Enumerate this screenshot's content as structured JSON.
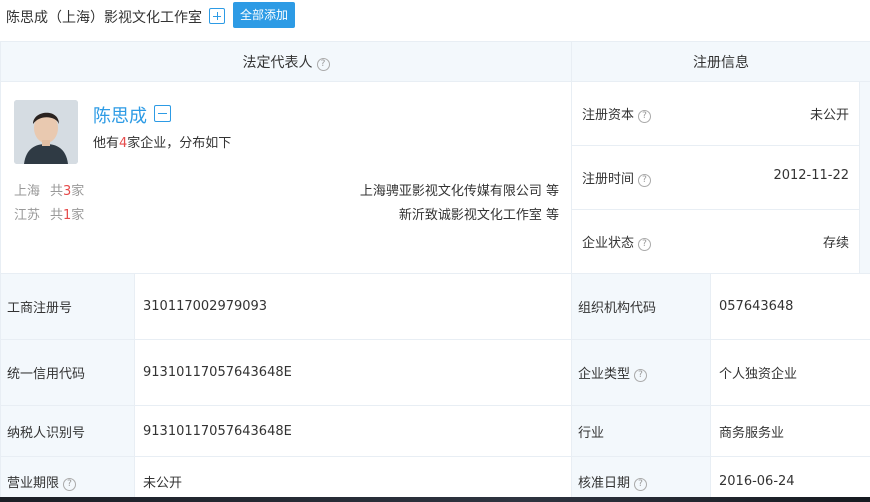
{
  "header": {
    "company_title": "陈思成（上海）影视文化工作室",
    "add_all_label": "全部添加"
  },
  "columns": {
    "legal_rep": "法定代表人",
    "registration": "注册信息"
  },
  "person": {
    "name": "陈思成",
    "dist_prefix": "他有",
    "dist_count": "4",
    "dist_suffix": "家企业，分布如下",
    "regions": [
      {
        "name": "上海",
        "count_prefix": "共",
        "count": "3",
        "count_suffix": "家",
        "company": "上海骋亚影视文化传媒有限公司 等"
      },
      {
        "name": "江苏",
        "count_prefix": "共",
        "count": "1",
        "count_suffix": "家",
        "company": "新沂致诚影视文化工作室 等"
      }
    ]
  },
  "registration": {
    "capital_label": "注册资本",
    "capital_value": "未公开",
    "date_label": "注册时间",
    "date_value": "2012-11-22",
    "status_label": "企业状态",
    "status_value": "存续"
  },
  "details": {
    "biz_reg_label": "工商注册号",
    "biz_reg_value": "310117002979093",
    "org_code_label": "组织机构代码",
    "org_code_value": "057643648",
    "credit_label": "统一信用代码",
    "credit_value": "91310117057643648E",
    "type_label": "企业类型",
    "type_value": "个人独资企业",
    "tax_label": "纳税人识别号",
    "tax_value": "91310117057643648E",
    "industry_label": "行业",
    "industry_value": "商务服务业",
    "term_label": "营业期限",
    "term_value": "未公开",
    "approve_label": "核准日期",
    "approve_value": "2016-06-24"
  },
  "colors": {
    "accent": "#2d9be5",
    "highlight": "#e64b4b",
    "label_bg": "#f3f8fc",
    "border": "#e8eef4"
  },
  "icons": {
    "help": "question-circle-icon",
    "add": "plus-square-icon",
    "collapse": "minus-square-icon"
  }
}
